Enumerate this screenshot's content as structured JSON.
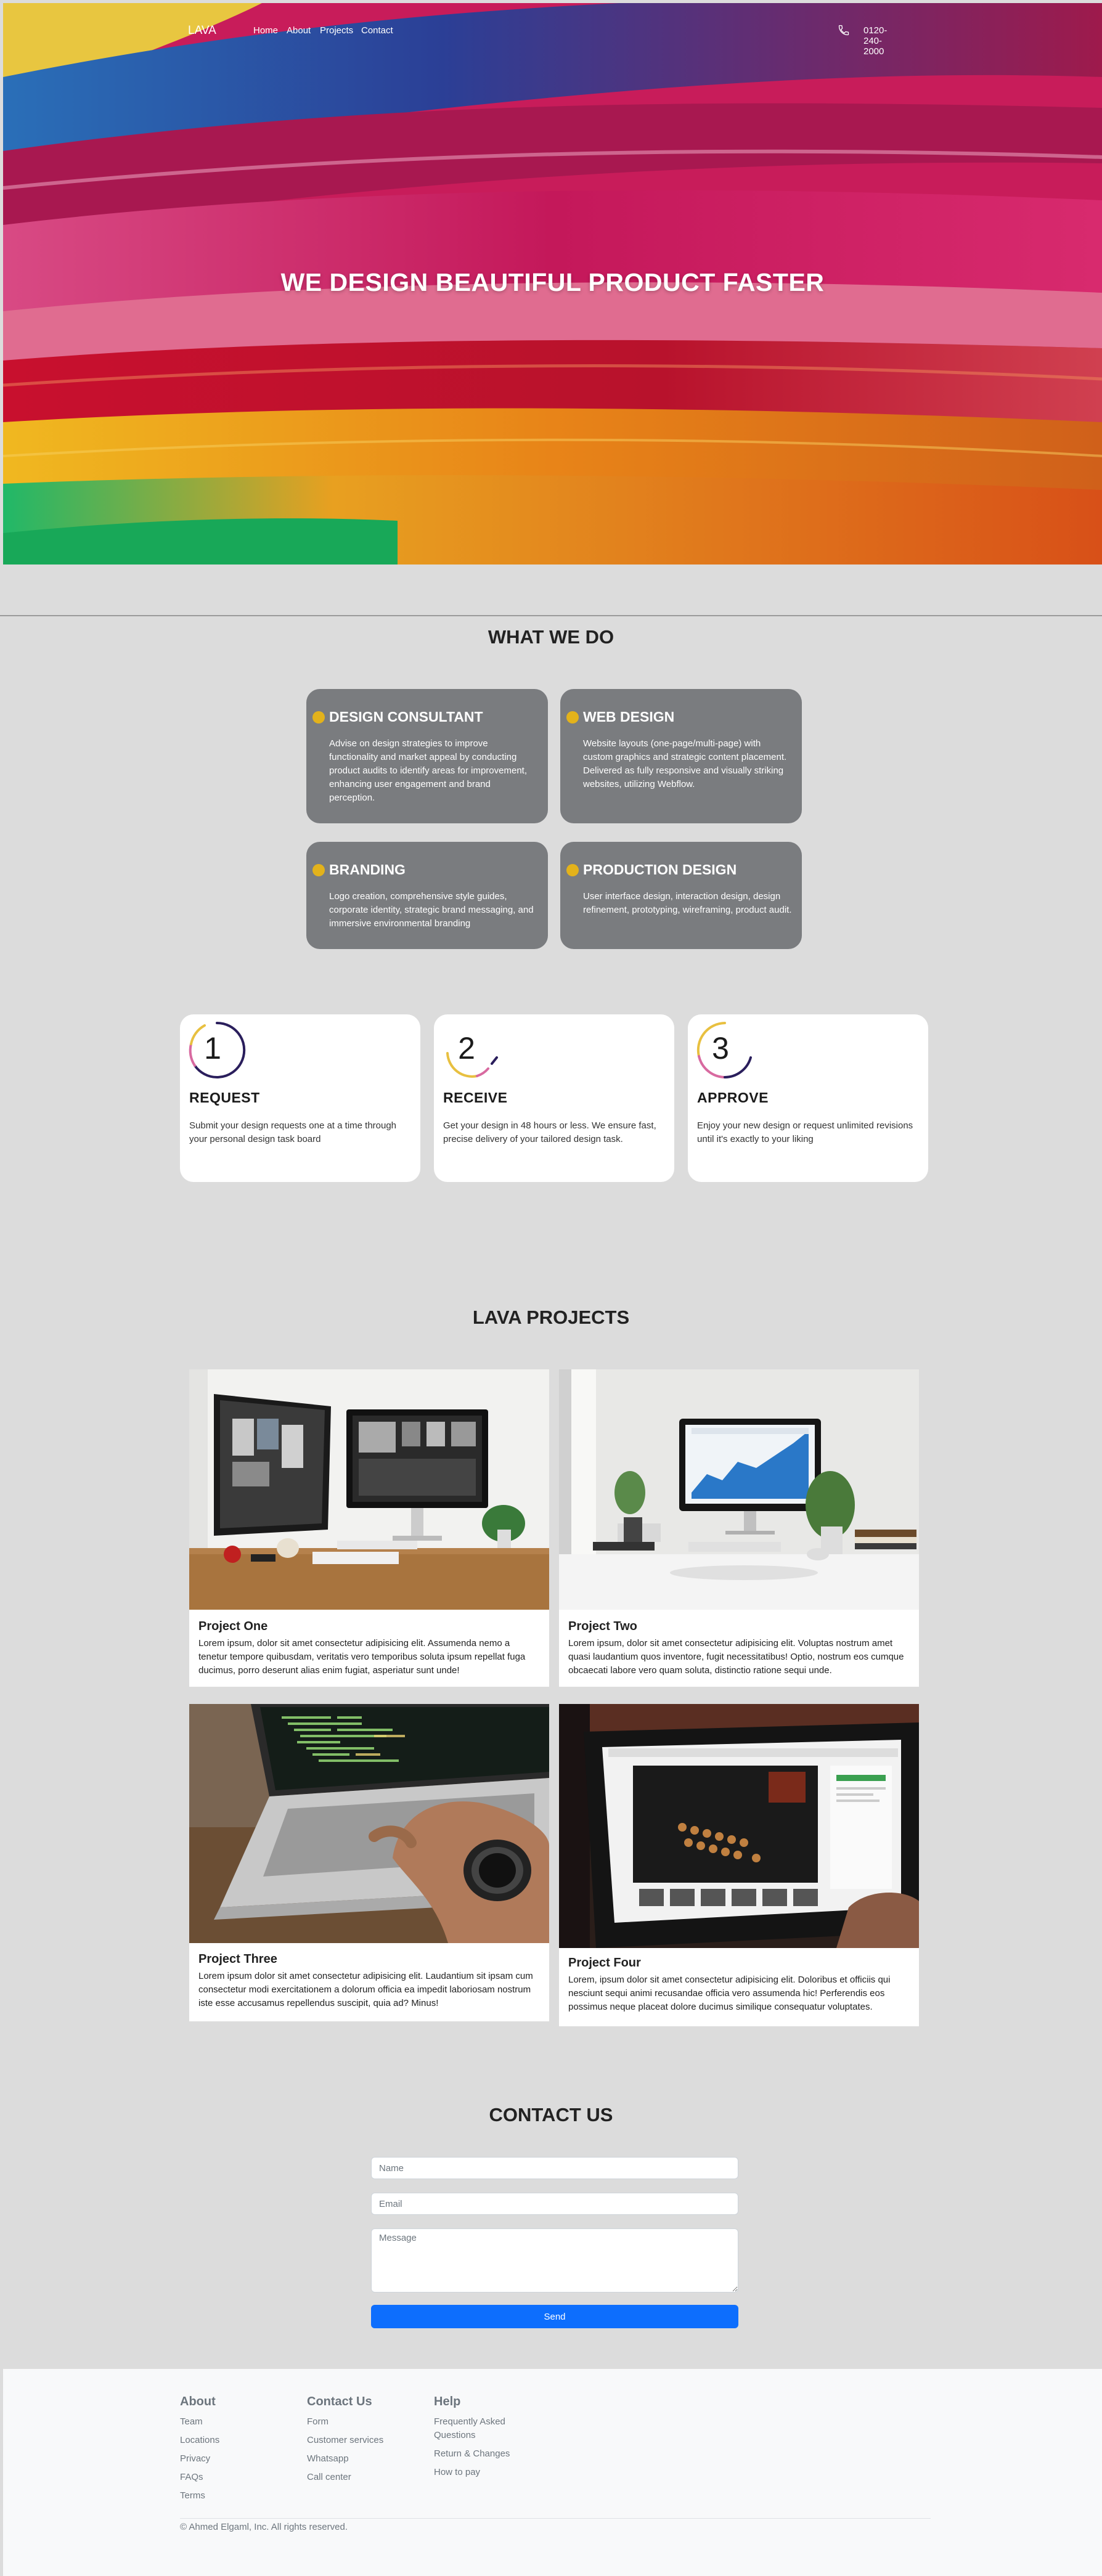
{
  "colors": {
    "page_bg": "#dcdcdc",
    "card_gray": "#7a7c7f",
    "accent_gold": "#e3b21b",
    "send_blue": "#0d6efd",
    "footer_bg": "#f8f9fa"
  },
  "nav": {
    "brand": "LAVA",
    "links": [
      "Home",
      "About",
      "Projects",
      "Contact"
    ],
    "phone_icon": "phone-icon",
    "phone": "0120-240-2000"
  },
  "hero": {
    "title": "WE DESIGN BEAUTIFUL PRODUCT FASTER"
  },
  "services": {
    "title": "WHAT WE DO",
    "items": [
      {
        "title": "DESIGN CONSULTANT",
        "desc": "Advise on design strategies to improve functionality and market appeal by conducting product audits to identify areas for improvement, enhancing user engagement and brand perception."
      },
      {
        "title": "WEB DESIGN",
        "desc": "Website layouts (one-page/multi-page) with custom graphics and strategic content placement. Delivered as fully responsive and visually striking websites, utilizing Webflow."
      },
      {
        "title": "BRANDING",
        "desc": "Logo creation, comprehensive style guides, corporate identity, strategic brand messaging, and immersive environmental branding"
      },
      {
        "title": "PRODUCTION DESIGN",
        "desc": "User interface design, interaction design, design refinement, prototyping, wireframing, product audit."
      }
    ]
  },
  "process": {
    "steps": [
      {
        "number": "1",
        "title": "REQUEST",
        "desc": "Submit your design requests one at a time through your personal design task board"
      },
      {
        "number": "2",
        "title": "RECEIVE",
        "desc": "Get your design in 48 hours or less. We ensure fast, precise delivery of your tailored design task."
      },
      {
        "number": "3",
        "title": "APPROVE",
        "desc": "Enjoy your new design or request unlimited revisions until it's exactly to your liking"
      }
    ]
  },
  "projects": {
    "title": "LAVA PROJECTS",
    "items": [
      {
        "title": "Project One",
        "desc": "Lorem ipsum, dolor sit amet consectetur adipisicing elit. Assumenda nemo a tenetur tempore quibusdam, veritatis vero temporibus soluta ipsum repellat fuga ducimus, porro deserunt alias enim fugiat, asperiatur sunt unde!"
      },
      {
        "title": "Project Two",
        "desc": "Lorem ipsum, dolor sit amet consectetur adipisicing elit. Voluptas nostrum amet quasi laudantium quos inventore, fugit necessitatibus! Optio, nostrum eos cumque obcaecati labore vero quam soluta, distinctio ratione sequi unde."
      },
      {
        "title": "Project Three",
        "desc": "Lorem ipsum dolor sit amet consectetur adipisicing elit. Laudantium sit ipsam cum consectetur modi exercitationem a dolorum officia ea impedit laboriosam nostrum iste esse accusamus repellendus suscipit, quia ad? Minus!"
      },
      {
        "title": "Project Four",
        "desc": "Lorem, ipsum dolor sit amet consectetur adipisicing elit. Doloribus et officiis qui nesciunt sequi animi recusandae officia vero assumenda hic! Perferendis eos possimus neque placeat dolore ducimus similique consequatur voluptates."
      }
    ]
  },
  "contact": {
    "title": "CONTACT US",
    "name_placeholder": "Name",
    "email_placeholder": "Email",
    "message_placeholder": "Message",
    "send_label": "Send"
  },
  "footer": {
    "columns": [
      {
        "heading": "About",
        "links": [
          "Team",
          "Locations",
          "Privacy",
          "FAQs",
          "Terms"
        ]
      },
      {
        "heading": "Contact Us",
        "links": [
          "Form",
          "Customer services",
          "Whatsapp",
          "Call center"
        ]
      },
      {
        "heading": "Help",
        "links": [
          "Frequently Asked Questions",
          "Return & Changes",
          "How to pay"
        ]
      }
    ],
    "copyright": "© Ahmed Elgaml, Inc. All rights reserved."
  }
}
